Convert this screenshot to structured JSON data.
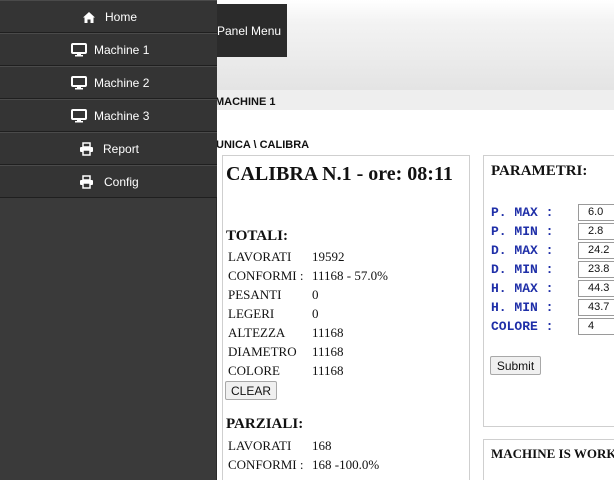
{
  "header": {
    "panel_menu": "Panel Menu"
  },
  "page": {
    "machine_title": "MACHINE 1",
    "breadcrumb": "UNICA \\ CALIBRA"
  },
  "sidebar": {
    "items": [
      {
        "label": "Home",
        "icon": "home-icon"
      },
      {
        "label": "Machine 1",
        "icon": "monitor-icon"
      },
      {
        "label": "Machine 2",
        "icon": "monitor-icon"
      },
      {
        "label": "Machine 3",
        "icon": "monitor-icon"
      },
      {
        "label": "Report",
        "icon": "printer-icon"
      },
      {
        "label": "Config",
        "icon": "printer-icon"
      }
    ]
  },
  "calibra": {
    "title": "CALIBRA N.1 - ore: 08:11",
    "totali": {
      "heading": "TOTALI:",
      "rows": [
        {
          "label": "LAVORATI",
          "value": "19592"
        },
        {
          "label": "CONFORMI :",
          "value": "11168 - 57.0%"
        },
        {
          "label": "PESANTI",
          "value": "0"
        },
        {
          "label": "LEGERI",
          "value": "0"
        },
        {
          "label": "ALTEZZA",
          "value": "11168"
        },
        {
          "label": "DIAMETRO",
          "value": "11168"
        },
        {
          "label": "COLORE",
          "value": "11168"
        }
      ],
      "clear_label": "CLEAR"
    },
    "parziali": {
      "heading": "PARZIALI:",
      "rows": [
        {
          "label": "LAVORATI",
          "value": "168"
        },
        {
          "label": "CONFORMI :",
          "value": "168 -100.0%"
        }
      ]
    }
  },
  "parametri": {
    "title": "PARAMETRI:",
    "rows": [
      {
        "label": "P. MAX :",
        "value": "6.0"
      },
      {
        "label": "P. MIN :",
        "value": "2.8"
      },
      {
        "label": "D. MAX :",
        "value": "24.2"
      },
      {
        "label": "D. MIN :",
        "value": "23.8"
      },
      {
        "label": "H. MAX :",
        "value": "44.3"
      },
      {
        "label": "H. MIN :",
        "value": "43.7"
      },
      {
        "label": "COLORE :",
        "value": "4"
      }
    ],
    "submit_label": "Submit"
  },
  "status": {
    "text": "MACHINE IS WORKING"
  },
  "colors": {
    "sidebar_bg": "#343434",
    "param_label": "#1f2fa8"
  }
}
